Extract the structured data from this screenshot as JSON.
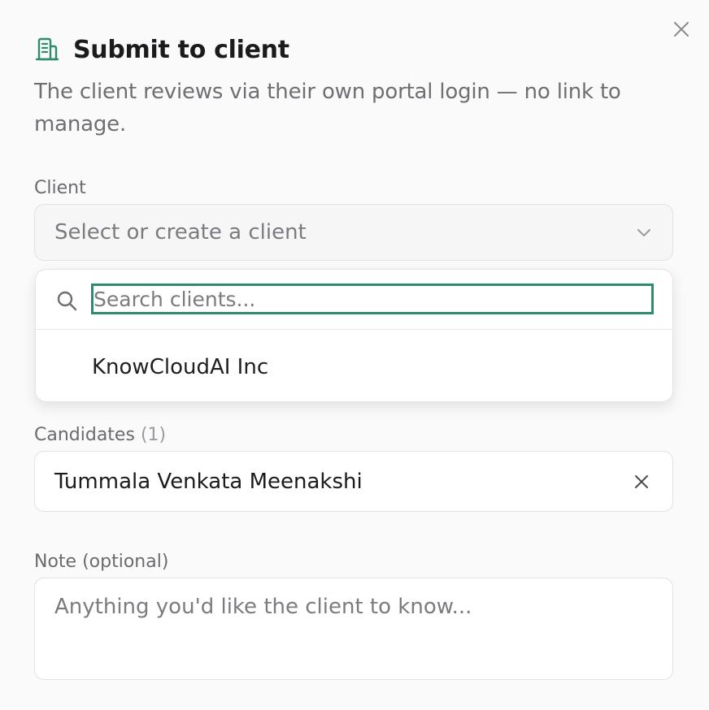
{
  "dialog": {
    "title": "Submit to client",
    "subtitle": "The client reviews via their own portal login — no link to manage.",
    "accent_color": "#2e8c6a"
  },
  "client": {
    "label": "Client",
    "select_placeholder": "Select or create a client",
    "dropdown": {
      "search_placeholder": "Search clients...",
      "search_value": "",
      "options": [
        "KnowCloudAI Inc"
      ]
    }
  },
  "candidates": {
    "label": "Candidates",
    "count": "(1)",
    "selected": "Tummala Venkata Meenakshi"
  },
  "note": {
    "label": "Note (optional)",
    "placeholder": "Anything you'd like the client to know...",
    "value": ""
  },
  "icons": {
    "title_icon": "building-icon",
    "close": "close-icon",
    "select": "chevron-down-icon",
    "search": "search-icon",
    "remove": "close-icon"
  }
}
